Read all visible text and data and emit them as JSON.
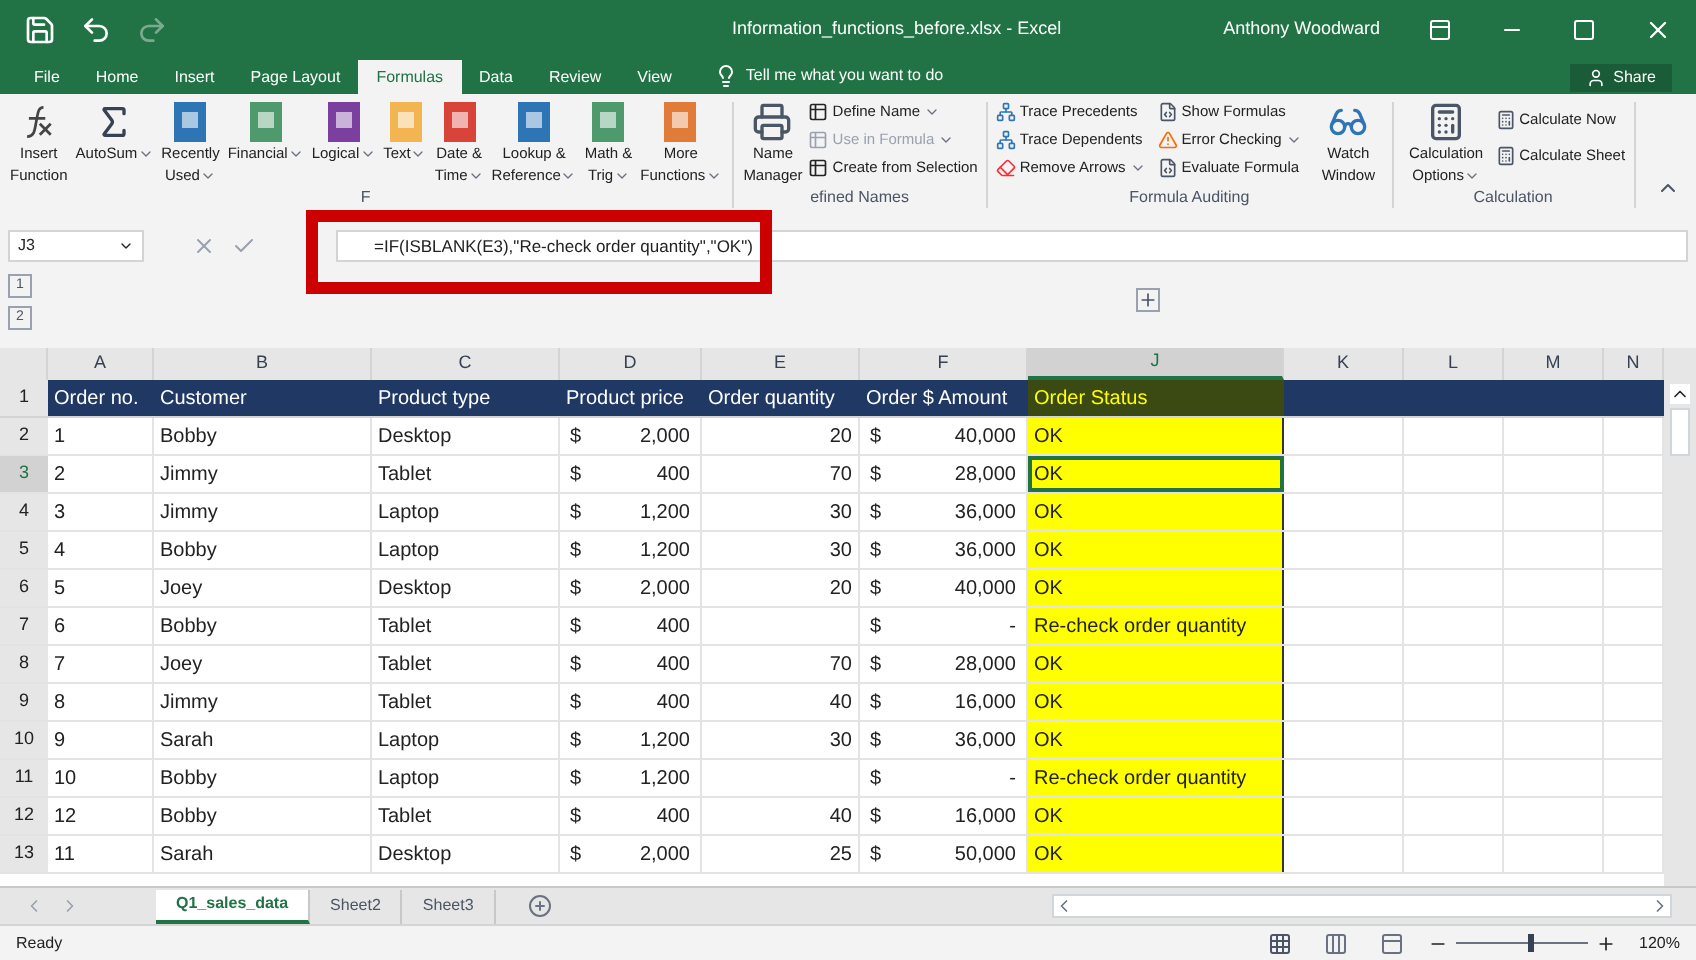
{
  "window": {
    "title": "Information_functions_before.xlsx - Excel",
    "user": "Anthony Woodward"
  },
  "ribbon_tabs": [
    {
      "label": "File",
      "selected": false
    },
    {
      "label": "Home",
      "selected": false
    },
    {
      "label": "Insert",
      "selected": false
    },
    {
      "label": "Page Layout",
      "selected": false
    },
    {
      "label": "Formulas",
      "selected": true
    },
    {
      "label": "Data",
      "selected": false
    },
    {
      "label": "Review",
      "selected": false
    },
    {
      "label": "View",
      "selected": false
    }
  ],
  "tell_me": "Tell me what you want to do",
  "share": "Share",
  "function_library": {
    "label": "F",
    "buttons": [
      {
        "kind": "fx",
        "lines": [
          "Insert",
          "Function"
        ],
        "dropdown": false
      },
      {
        "kind": "sigma",
        "lines": [
          "AutoSum"
        ],
        "dropdown": true
      },
      {
        "kind": "book",
        "color": "#2e75b6",
        "lines": [
          "Recently",
          "Used"
        ],
        "dropdown": true
      },
      {
        "kind": "book",
        "color": "#4f9a6d",
        "lines": [
          "Financial"
        ],
        "dropdown": true
      },
      {
        "kind": "book",
        "color": "#7b3fa0",
        "lines": [
          "Logical"
        ],
        "dropdown": true
      },
      {
        "kind": "book",
        "color": "#f2b552",
        "lines": [
          "Text"
        ],
        "dropdown": true
      },
      {
        "kind": "book",
        "color": "#d9443a",
        "lines": [
          "Date &",
          "Time"
        ],
        "dropdown": true
      },
      {
        "kind": "book",
        "color": "#2e75b6",
        "lines": [
          "Lookup &",
          "Reference"
        ],
        "dropdown": true
      },
      {
        "kind": "book",
        "color": "#4f9a6d",
        "lines": [
          "Math &",
          "Trig"
        ],
        "dropdown": true
      },
      {
        "kind": "book",
        "color": "#e07b39",
        "lines": [
          "More",
          "Functions"
        ],
        "dropdown": true
      }
    ]
  },
  "defined_names": {
    "label": "efined Names",
    "manager": [
      "Name",
      "Manager"
    ],
    "items": [
      {
        "label": "Define Name",
        "dropdown": true,
        "disabled": false
      },
      {
        "label": "Use in Formula",
        "dropdown": true,
        "disabled": true
      },
      {
        "label": "Create from Selection",
        "dropdown": false,
        "disabled": false
      }
    ]
  },
  "formula_auditing": {
    "label": "Formula Auditing",
    "col1": [
      {
        "label": "Trace Precedents",
        "dropdown": false
      },
      {
        "label": "Trace Dependents",
        "dropdown": false
      },
      {
        "label": "Remove Arrows",
        "dropdown": true
      }
    ],
    "col2": [
      {
        "label": "Show Formulas",
        "dropdown": false
      },
      {
        "label": "Error Checking",
        "dropdown": true
      },
      {
        "label": "Evaluate Formula",
        "dropdown": false
      }
    ],
    "watch": [
      "Watch",
      "Window"
    ]
  },
  "calculation": {
    "label": "Calculation",
    "options": [
      "Calculation",
      "Options"
    ],
    "items": [
      "Calculate Now",
      "Calculate Sheet"
    ]
  },
  "formula_bar": {
    "name_box": "J3",
    "formula": "=IF(ISBLANK(E3),\"Re-check order quantity\",\"OK\")"
  },
  "outline_levels": [
    "1",
    "2"
  ],
  "columns": [
    {
      "label": "A",
      "selected": false
    },
    {
      "label": "B",
      "selected": false
    },
    {
      "label": "C",
      "selected": false
    },
    {
      "label": "D",
      "selected": false
    },
    {
      "label": "E",
      "selected": false
    },
    {
      "label": "F",
      "selected": false
    },
    {
      "label": "J",
      "selected": true
    },
    {
      "label": "K",
      "selected": false
    },
    {
      "label": "L",
      "selected": false
    },
    {
      "label": "M",
      "selected": false
    },
    {
      "label": "N",
      "selected": false
    }
  ],
  "header_row": {
    "number": "1",
    "cells": [
      "Order no.",
      "Customer",
      "Product type",
      "Product price",
      "Order quantity",
      "Order $ Amount",
      "Order Status"
    ]
  },
  "rows": [
    {
      "number": "2",
      "order": "1",
      "customer": "Bobby",
      "product": "Desktop",
      "price": [
        "$",
        "2,000"
      ],
      "qty": "20",
      "amount": [
        "$",
        "40,000"
      ],
      "status": "OK",
      "selected": false
    },
    {
      "number": "3",
      "order": "2",
      "customer": "Jimmy",
      "product": "Tablet",
      "price": [
        "$",
        "400"
      ],
      "qty": "70",
      "amount": [
        "$",
        "28,000"
      ],
      "status": "OK",
      "selected": true
    },
    {
      "number": "4",
      "order": "3",
      "customer": "Jimmy",
      "product": "Laptop",
      "price": [
        "$",
        "1,200"
      ],
      "qty": "30",
      "amount": [
        "$",
        "36,000"
      ],
      "status": "OK",
      "selected": false
    },
    {
      "number": "5",
      "order": "4",
      "customer": "Bobby",
      "product": "Laptop",
      "price": [
        "$",
        "1,200"
      ],
      "qty": "30",
      "amount": [
        "$",
        "36,000"
      ],
      "status": "OK",
      "selected": false
    },
    {
      "number": "6",
      "order": "5",
      "customer": "Joey",
      "product": "Desktop",
      "price": [
        "$",
        "2,000"
      ],
      "qty": "20",
      "amount": [
        "$",
        "40,000"
      ],
      "status": "OK",
      "selected": false
    },
    {
      "number": "7",
      "order": "6",
      "customer": "Bobby",
      "product": "Tablet",
      "price": [
        "$",
        "400"
      ],
      "amount": [
        "$",
        "-"
      ],
      "status": "Re-check order quantity",
      "selected": false
    },
    {
      "number": "8",
      "order": "7",
      "customer": "Joey",
      "product": "Tablet",
      "price": [
        "$",
        "400"
      ],
      "qty": "70",
      "amount": [
        "$",
        "28,000"
      ],
      "status": "OK",
      "selected": false
    },
    {
      "number": "9",
      "order": "8",
      "customer": "Jimmy",
      "product": "Tablet",
      "price": [
        "$",
        "400"
      ],
      "qty": "40",
      "amount": [
        "$",
        "16,000"
      ],
      "status": "OK",
      "selected": false
    },
    {
      "number": "10",
      "order": "9",
      "customer": "Sarah",
      "product": "Laptop",
      "price": [
        "$",
        "1,200"
      ],
      "qty": "30",
      "amount": [
        "$",
        "36,000"
      ],
      "status": "OK",
      "selected": false
    },
    {
      "number": "11",
      "order": "10",
      "customer": "Bobby",
      "product": "Laptop",
      "price": [
        "$",
        "1,200"
      ],
      "amount": [
        "$",
        "-"
      ],
      "status": "Re-check order quantity",
      "selected": false
    },
    {
      "number": "12",
      "order": "12",
      "customer": "Bobby",
      "product": "Tablet",
      "price": [
        "$",
        "400"
      ],
      "qty": "40",
      "amount": [
        "$",
        "16,000"
      ],
      "status": "OK",
      "selected": false
    },
    {
      "number": "13",
      "order": "11",
      "customer": "Sarah",
      "product": "Desktop",
      "price": [
        "$",
        "2,000"
      ],
      "qty": "25",
      "amount": [
        "$",
        "50,000"
      ],
      "status": "OK",
      "selected": false
    }
  ],
  "sheet_tabs": [
    {
      "label": "Q1_sales_data",
      "selected": true
    },
    {
      "label": "Sheet2",
      "selected": false
    },
    {
      "label": "Sheet3",
      "selected": false
    }
  ],
  "status_bar": {
    "text": "Ready",
    "zoom": "120%",
    "level": 0.55
  }
}
